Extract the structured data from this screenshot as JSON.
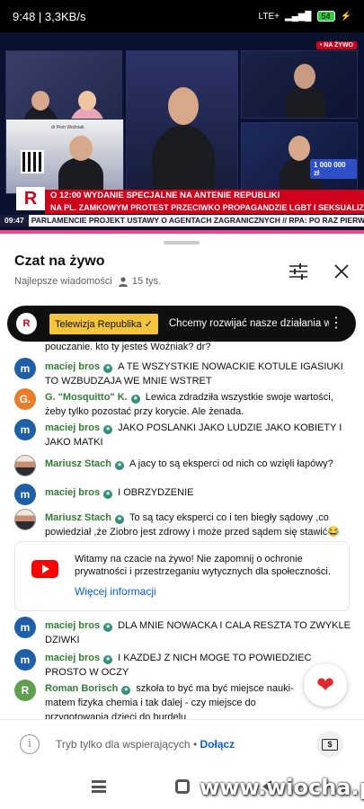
{
  "status_bar": {
    "time": "9:48",
    "speed": "3,3KB/s",
    "network": "LTE+",
    "battery": "54"
  },
  "video": {
    "live_badge": "• NA ŻYWO",
    "tile_d_caption": "dr Piotr Woźniak",
    "counter": "1 000 000 zł",
    "logo_letter": "R",
    "ticker_line1": "O 12:00 WYDANIE SPECJALNE NA ANTENIE REPUBLIKI",
    "ticker_line2": "NA PL. ZAMKOWYM PROTEST PRZECIWKO PROPAGANDZIE LGBT I SEKSUALIZACJI DZIECI",
    "ticker_time": "09:47",
    "ticker_line3": "PARLAMENCIE PROJEKT USTAWY O AGENTACH ZAGRANICZNYCH // RPA: PO RAZ PIERWSZY"
  },
  "chat": {
    "title": "Czat na żywo",
    "filter_label": "Najlepsze wiadomości",
    "viewers": "15 tys."
  },
  "pinned": {
    "avatar_letter": "R",
    "channel": "Telewizja Republika ✓",
    "text": "Chcemy rozwijać nasze działania w You..."
  },
  "messages": [
    {
      "avatar": "",
      "author": "",
      "text": "pouczanie. kto ty jesteś Woźniak? dr?"
    },
    {
      "avatar": "m",
      "author": "maciej bros",
      "text": "A TE WSZYSTKIE NOWACKIE KOTULE IGASIUKI TO WZBUDZAJA WE MNIE WSTRET"
    },
    {
      "avatar": "G.",
      "author": "G. \"Mosquitto\" K.",
      "text": "Lewica zdradziła wszystkie swoje wartości, żeby tylko pozostać przy korycie. Ale żenada."
    },
    {
      "avatar": "m",
      "author": "maciej bros",
      "text": "JAKO POSLANKI JAKO LUDZIE JAKO KOBIETY I JAKO MATKI"
    },
    {
      "avatar": "",
      "author": "Mariusz Stach",
      "text": "A jacy to są eksperci od nich co wzięli łapówy?"
    },
    {
      "avatar": "m",
      "author": "maciej bros",
      "text": "I OBRZYDZENIE"
    },
    {
      "avatar": "",
      "author": "Mariusz Stach",
      "text": "To są tacy eksperci co i ten biegły sądowy ,co powiedział ,że Ziobro jest zdrowy i może przed sądem się stawić😂"
    },
    {
      "avatar": "m",
      "author": "maciej bros",
      "text": "DLA MNIE NOWACKA I CALA RESZTA TO ZWYKLE DZIWKI"
    },
    {
      "avatar": "m",
      "author": "maciej bros",
      "text": "I KAZDEJ Z NICH MOGE TO POWIEDZIEC PROSTO W OCZY"
    },
    {
      "avatar": "R",
      "author": "Roman Borisch",
      "text": "szkoła to być ma być miejsce nauki- matem fizyka chemia i tak dalej - czy miejsce do przygotowania dzieci do burdelu"
    }
  ],
  "notice": {
    "text": "Witamy na czacie na żywo! Nie zapomnij o ochronie prywatności i przestrzeganiu wytycznych dla społeczności.",
    "link": "Więcej informacji"
  },
  "input": {
    "info_glyph": "i",
    "placeholder": "Tryb tylko dla wspierających",
    "separator": "•",
    "join": "Dołącz",
    "money_glyph": "$"
  },
  "reaction": {
    "glyph": "❤"
  },
  "watermark": "www.wiocha.pl",
  "colors": {
    "live_red": "#d0021b",
    "author_green": "#2f7d32",
    "link_blue": "#065fd4",
    "pinned_gold": "#f3c43c"
  },
  "icons": [
    "filter-icon",
    "close-icon",
    "more-vert-icon",
    "verified-badge-icon",
    "people-icon",
    "youtube-logo-icon",
    "info-icon",
    "money-icon",
    "heart-icon"
  ]
}
